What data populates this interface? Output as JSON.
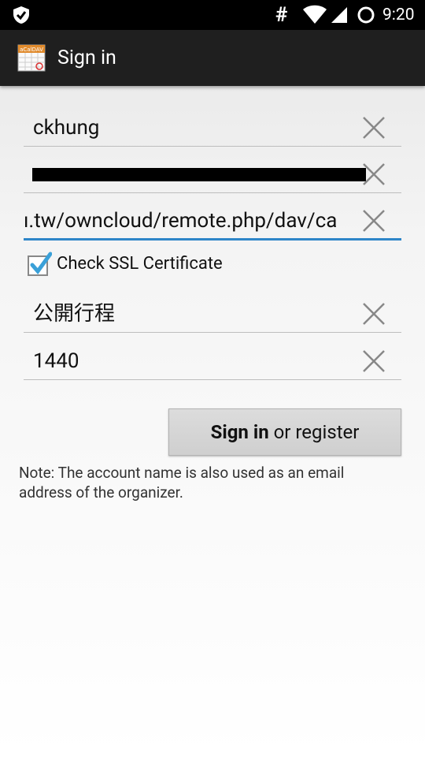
{
  "status_bar": {
    "time": "9:20",
    "icons": [
      "shield-icon",
      "hash-icon",
      "wifi-icon",
      "signal-icon",
      "battery-loading-icon"
    ]
  },
  "action_bar": {
    "title": "Sign in",
    "app_icon_text": "aCalDAV"
  },
  "form": {
    "username": "ckhung",
    "password_redacted": true,
    "url": "ı.tw/owncloud/remote.php/dav/ca",
    "check_ssl_label": "Check SSL Certificate",
    "check_ssl_checked": true,
    "calendar_name": "公開行程",
    "sync_interval": "1440"
  },
  "signin_button": {
    "bold": "Sign in",
    "rest": " or register"
  },
  "note": "Note: The account name is also used as an email address of the organizer.",
  "colors": {
    "accent": "#2e86c8",
    "checkbox": "#3aa0d8",
    "action_bar": "#1f1f1f",
    "status_bar": "#000000"
  }
}
